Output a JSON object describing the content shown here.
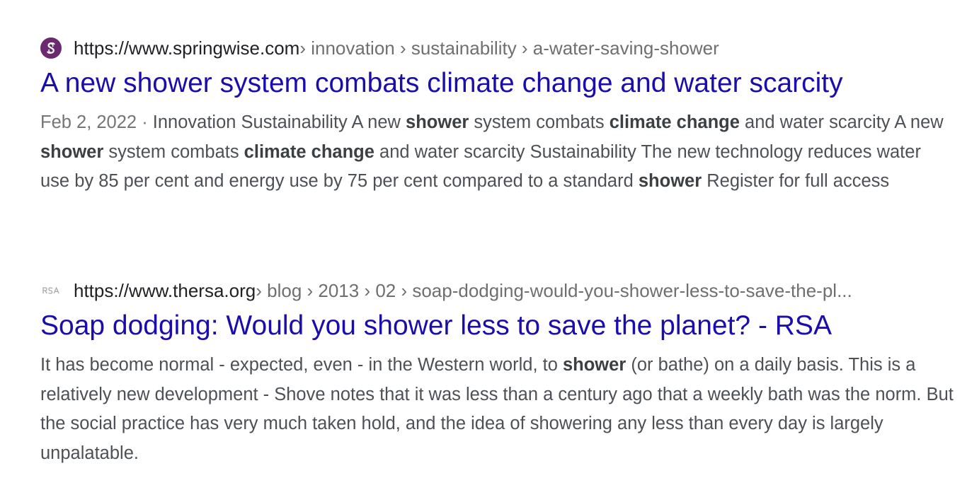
{
  "colors": {
    "title_link": "#1a0dab",
    "url_domain": "#202124",
    "url_path": "#6f6f6f",
    "snippet_text": "#4d5156",
    "springwise_favicon": "#6b2a6f"
  },
  "results": [
    {
      "favicon": "springwise-favicon",
      "url_domain": "https://www.springwise.com",
      "url_path": " › innovation › sustainability › a-water-saving-shower",
      "title": "A new shower system combats climate change and water scarcity",
      "date": "Feb 2, 2022",
      "separator": " · ",
      "snippet_parts": [
        "Innovation Sustainability A new ",
        "shower",
        " system combats ",
        "climate change",
        " and water scarcity A new ",
        "shower",
        " system combats ",
        "climate change",
        " and water scarcity Sustainability The new technology reduces water use by 85 per cent and energy use by 75 per cent compared to a standard ",
        "shower",
        " Register for full access"
      ]
    },
    {
      "favicon": "rsa-favicon",
      "url_domain": "https://www.thersa.org",
      "url_path": " › blog › 2013 › 02 › soap-dodging-would-you-shower-less-to-save-the-pl...",
      "title": "Soap dodging: Would you shower less to save the planet? - RSA",
      "snippet_parts": [
        "It has become normal - expected, even - in the Western world, to ",
        "shower",
        " (or bathe) on a daily basis. This is a relatively new development - Shove notes that it was less than a century ago that a weekly bath was the norm. But the social practice has very much taken hold, and the idea of showering any less than every day is largely unpalatable."
      ]
    }
  ]
}
